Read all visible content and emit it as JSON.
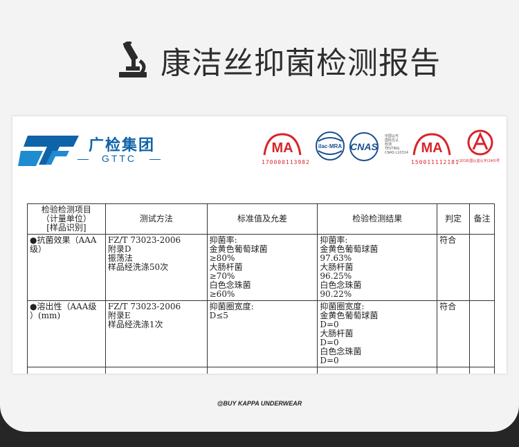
{
  "heading": {
    "title": "康洁丝抑菌检测报告",
    "icon": "microscope-icon"
  },
  "report_header": {
    "brand_cn": "广检集团",
    "brand_en": "GTTC",
    "cert_ma_1_number": "170000113982",
    "cert_ilac_label": "ilac·MRA",
    "cert_cnas_label": "CNAS",
    "cert_cnas_text": [
      "中国认可",
      "国际互认",
      "检测",
      "TESTING",
      "CNAS L10314"
    ],
    "cert_ma_2_number": "150011112181",
    "cert_cal_text": "(2018)国认监认字(240)号",
    "ma_label": "MA"
  },
  "table": {
    "headers": [
      "检验检测项目\n（计量单位）\n[样品识别]",
      "测试方法",
      "标准值及允差",
      "检验检测结果",
      "判定",
      "备注"
    ],
    "rows": [
      {
        "item": "●抗菌效果（AAA\n级）",
        "method": "FZ/T 73023-2006\n附录D\n振荡法\n样品经洗涤50次",
        "standard": "抑菌率:\n金黄色葡萄球菌\n≥80%\n大肠杆菌\n≥70%\n白色念珠菌\n≥60%",
        "result": "抑菌率:\n金黄色葡萄球菌\n97.63%\n大肠杆菌\n96.25%\n白色念珠菌\n90.22%",
        "verdict": "符合",
        "note": ""
      },
      {
        "item": "●溶出性（AAA级\n）(mm)",
        "method": "FZ/T 73023-2006\n附录E\n样品经洗涤1次",
        "standard": "抑菌圈宽度:\nD≤5",
        "result": "抑菌圈宽度:\n金黄色葡萄球菌\nD=0\n大肠杆菌\nD=0\n白色念珠菌\nD=0",
        "verdict": "符合",
        "note": ""
      }
    ]
  },
  "footer": {
    "text": "@BUY KAPPA UNDERWEAR"
  },
  "colors": {
    "brand_blue": "#0f63a8",
    "ma_red": "#d8232a",
    "page_bg": "#f3f3f3",
    "frame_bg": "#262626"
  }
}
